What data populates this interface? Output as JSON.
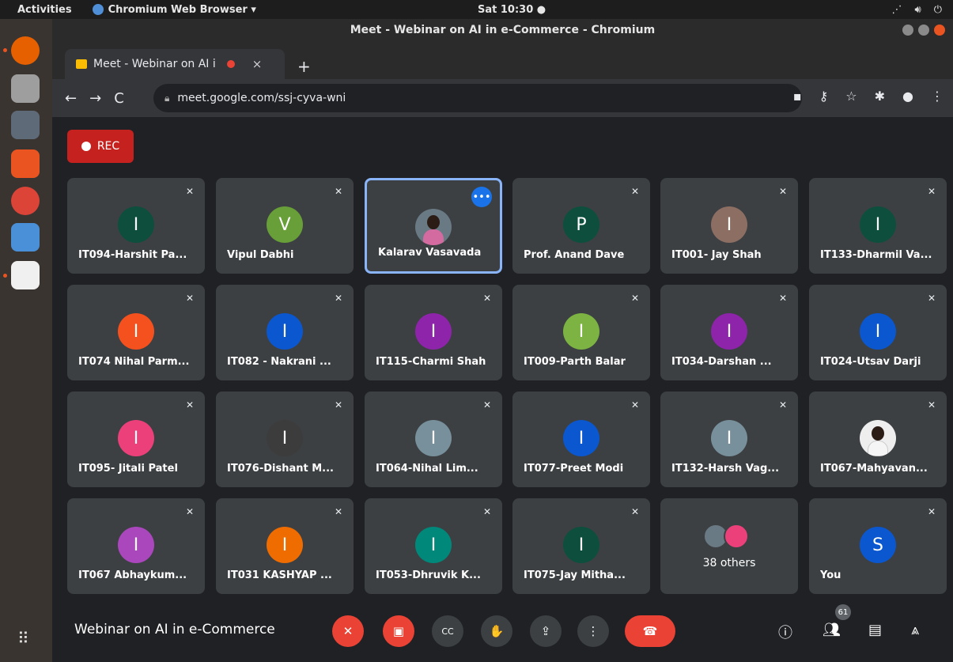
{
  "ubuntu": {
    "activities": "Activities",
    "app_menu": "Chromium Web Browser ▾",
    "clock": "Sat 10:30 ●",
    "sys_icons": [
      "network-icon",
      "volume-icon",
      "power-icon"
    ]
  },
  "window": {
    "title": "Meet - Webinar on AI in e-Commerce - Chromium"
  },
  "tab": {
    "label": "Meet - Webinar on AI i",
    "close": "×",
    "new_tab": "+"
  },
  "address": {
    "url": "meet.google.com/ssj-cyva-wni"
  },
  "meet": {
    "rec_label": "REC",
    "participants": [
      {
        "name": "IT094-Harshit Pa...",
        "initial": "I",
        "color": "#0d4f3c"
      },
      {
        "name": "Vipul Dabhi",
        "initial": "V",
        "color": "#689f38"
      },
      {
        "name": "Kalarav Vasavada",
        "initial": "",
        "color": "",
        "photo": true,
        "active": true
      },
      {
        "name": "Prof. Anand Dave",
        "initial": "P",
        "color": "#0d4f3c"
      },
      {
        "name": "IT001- Jay Shah",
        "initial": "I",
        "color": "#8d6e63"
      },
      {
        "name": "IT133-Dharmil Va...",
        "initial": "I",
        "color": "#0d4f3c"
      },
      {
        "name": "IT074 Nihal Parm...",
        "initial": "I",
        "color": "#f4511e"
      },
      {
        "name": "IT082 - Nakrani ...",
        "initial": "I",
        "color": "#0b57d0"
      },
      {
        "name": "IT115-Charmi Shah",
        "initial": "I",
        "color": "#8e24aa"
      },
      {
        "name": "IT009-Parth Balar",
        "initial": "I",
        "color": "#7cb342"
      },
      {
        "name": "IT034-Darshan ...",
        "initial": "I",
        "color": "#8e24aa"
      },
      {
        "name": "IT024-Utsav Darji",
        "initial": "I",
        "color": "#0b57d0"
      },
      {
        "name": "IT095- Jitali Patel",
        "initial": "I",
        "color": "#ec407a"
      },
      {
        "name": "IT076-Dishant M...",
        "initial": "I",
        "color": "#3c3c3c"
      },
      {
        "name": "IT064-Nihal Lim...",
        "initial": "I",
        "color": "#78909c"
      },
      {
        "name": "IT077-Preet Modi",
        "initial": "I",
        "color": "#0b57d0"
      },
      {
        "name": "IT132-Harsh Vag...",
        "initial": "I",
        "color": "#78909c"
      },
      {
        "name": "IT067-Mahyavan...",
        "initial": "",
        "color": "",
        "photo": true
      },
      {
        "name": "IT067 Abhaykum...",
        "initial": "I",
        "color": "#ab47bc"
      },
      {
        "name": "IT031 KASHYAP ...",
        "initial": "I",
        "color": "#ef6c00"
      },
      {
        "name": "IT053-Dhruvik K...",
        "initial": "I",
        "color": "#00897b"
      },
      {
        "name": "IT075-Jay Mitha...",
        "initial": "I",
        "color": "#0d4f3c"
      },
      {
        "name": "38 others",
        "others": true
      },
      {
        "name": "You",
        "initial": "S",
        "color": "#0b57d0"
      }
    ]
  },
  "bottom": {
    "meeting_title": "Webinar on AI in e-Commerce",
    "people_count": "61"
  }
}
